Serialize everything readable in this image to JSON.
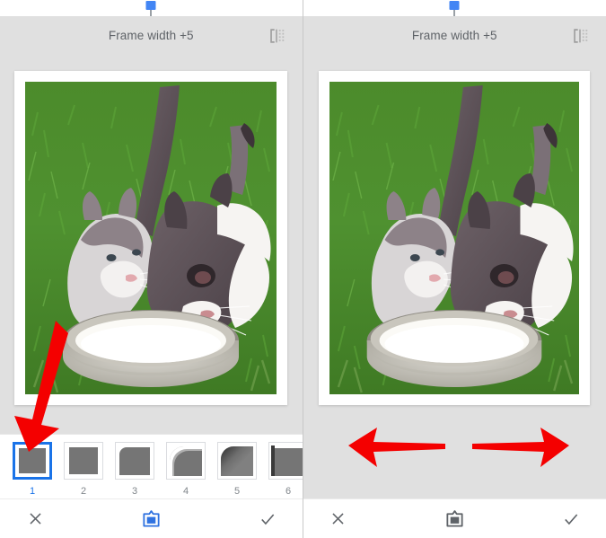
{
  "app": {
    "name": "photo-frame-editor",
    "accent_color": "#1a73e8",
    "slider_thumb_color": "#4285f4",
    "bg_color": "#e0e0e0"
  },
  "panels": [
    {
      "id": "left",
      "header": {
        "title": "Frame width +5",
        "compare_icon": "compare-split-icon"
      },
      "slider": {
        "name": "frame-width-slider",
        "position_percent": 50
      },
      "photo": {
        "alt": "Two grey and white kittens drinking milk from a metal bowl on green grass",
        "frame_style": "white-border"
      },
      "thumbnails": {
        "selected_index": 1,
        "items": [
          {
            "label": "1",
            "style": "plain-square"
          },
          {
            "label": "2",
            "style": "thin-border"
          },
          {
            "label": "3",
            "style": "rounded-corner"
          },
          {
            "label": "4",
            "style": "soft-rounded-highlight"
          },
          {
            "label": "5",
            "style": "dark-gradient-rounded"
          },
          {
            "label": "6",
            "style": "left-shadow-edge"
          }
        ]
      },
      "toolbar": {
        "cancel": {
          "label": "close-icon",
          "name": "cancel-button"
        },
        "frame": {
          "label": "frame-icon",
          "name": "frame-tool-button",
          "active": true
        },
        "confirm": {
          "label": "check-icon",
          "name": "confirm-button"
        }
      },
      "annotations": [
        {
          "type": "arrow",
          "direction": "down-left",
          "color": "#f40000",
          "target": "thumbnail-1"
        }
      ]
    },
    {
      "id": "right",
      "header": {
        "title": "Frame width +5",
        "compare_icon": "compare-split-icon"
      },
      "slider": {
        "name": "frame-width-slider",
        "position_percent": 50
      },
      "photo": {
        "alt": "Two grey and white kittens drinking milk from a metal bowl on green grass",
        "frame_style": "white-border"
      },
      "toolbar": {
        "cancel": {
          "label": "close-icon",
          "name": "cancel-button"
        },
        "frame": {
          "label": "frame-icon",
          "name": "frame-tool-button",
          "active": false
        },
        "confirm": {
          "label": "check-icon",
          "name": "confirm-button"
        }
      },
      "annotations": [
        {
          "type": "arrow",
          "direction": "left",
          "color": "#f40000"
        },
        {
          "type": "arrow",
          "direction": "right",
          "color": "#f40000"
        }
      ]
    }
  ]
}
